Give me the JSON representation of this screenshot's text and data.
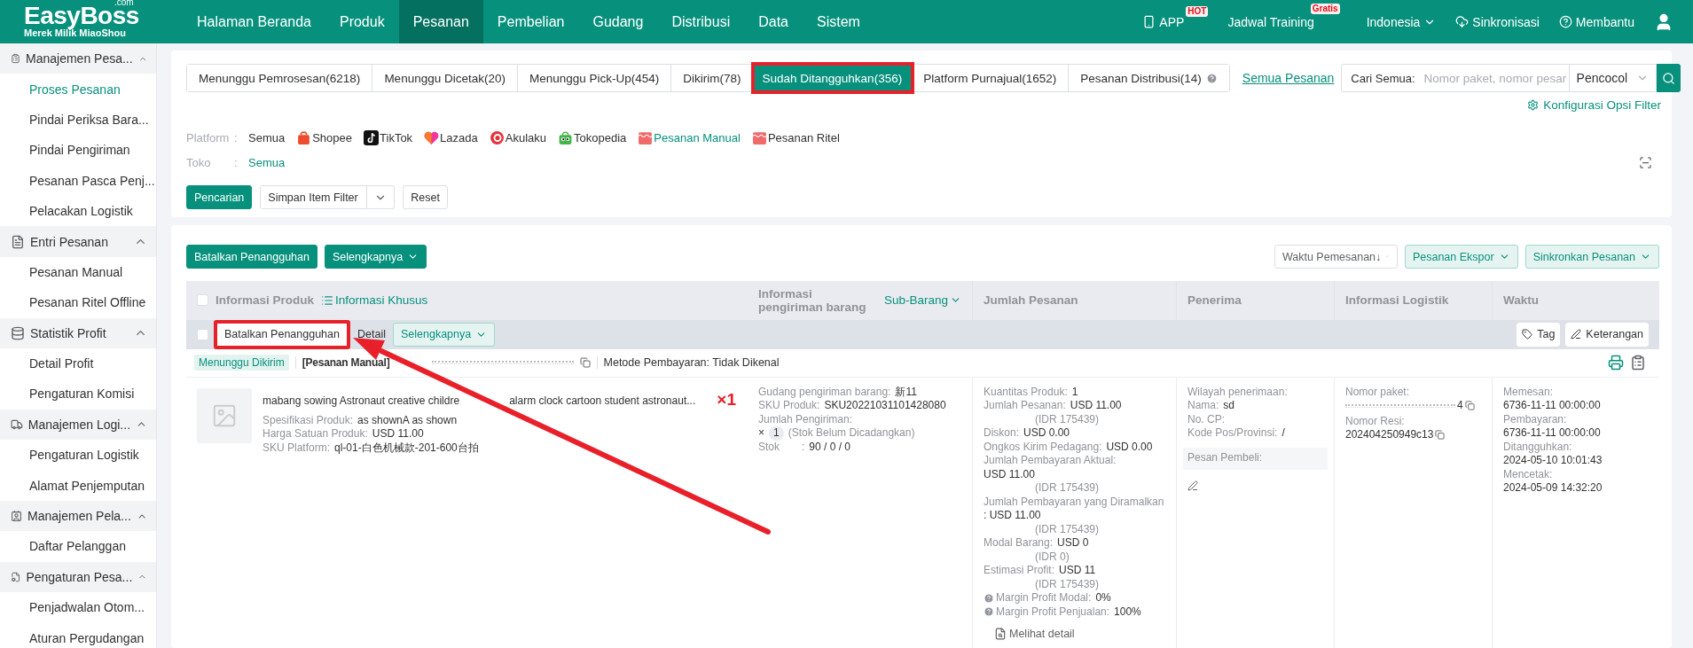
{
  "brand": {
    "name": "EasyBoss",
    "domain": ".com",
    "tagline": "Merek Milik MiaoShou"
  },
  "nav": [
    {
      "label": "Halaman Beranda",
      "selected": false
    },
    {
      "label": "Produk",
      "selected": false
    },
    {
      "label": "Pesanan",
      "selected": true
    },
    {
      "label": "Pembelian",
      "selected": false
    },
    {
      "label": "Gudang",
      "selected": false
    },
    {
      "label": "Distribusi",
      "selected": false
    },
    {
      "label": "Data",
      "selected": false
    },
    {
      "label": "Sistem",
      "selected": false
    }
  ],
  "header_actions": [
    {
      "kind": "app",
      "label": "APP",
      "badge": "HOT"
    },
    {
      "kind": "training",
      "label": "Jadwal Training",
      "badge": "Gratis"
    },
    {
      "kind": "language",
      "label": "Indonesia"
    },
    {
      "kind": "sync",
      "label": "Sinkronisasi"
    },
    {
      "kind": "help",
      "label": "Membantu"
    },
    {
      "kind": "user"
    }
  ],
  "sidebar": [
    {
      "label": "Manajemen Pesa...",
      "expanded": true,
      "children": [
        {
          "label": "Proses Pesanan",
          "selected": true
        },
        {
          "label": "Pindai Periksa Bara...",
          "selected": false
        },
        {
          "label": "Pindai Pengiriman",
          "selected": false
        },
        {
          "label": "Pesanan Pasca Penj...",
          "selected": false
        },
        {
          "label": "Pelacakan Logistik",
          "selected": false
        }
      ]
    },
    {
      "label": "Entri Pesanan",
      "expanded": true,
      "children": [
        {
          "label": "Pesanan Manual",
          "selected": false
        },
        {
          "label": "Pesanan Ritel Offline",
          "selected": false
        }
      ]
    },
    {
      "label": "Statistik Profit",
      "expanded": true,
      "children": [
        {
          "label": "Detail Profit",
          "selected": false
        },
        {
          "label": "Pengaturan Komisi",
          "selected": false
        }
      ]
    },
    {
      "label": "Manajemen Logi...",
      "expanded": true,
      "children": [
        {
          "label": "Pengaturan Logistik",
          "selected": false
        },
        {
          "label": "Alamat Penjemputan",
          "selected": false
        }
      ]
    },
    {
      "label": "Manajemen Pela...",
      "expanded": true,
      "children": [
        {
          "label": "Daftar Pelanggan",
          "selected": false
        }
      ]
    },
    {
      "label": "Pengaturan Pesa...",
      "expanded": true,
      "children": [
        {
          "label": "Penjadwalan Otom...",
          "selected": false
        },
        {
          "label": "Aturan Pergudangan",
          "selected": false
        }
      ]
    }
  ],
  "status_tabs": [
    {
      "label": "Menunggu Pemrosesan(6218)",
      "selected": false,
      "annotated": false,
      "help": false
    },
    {
      "label": "Menunggu Dicetak(20)",
      "selected": false,
      "annotated": false,
      "help": false
    },
    {
      "label": "Menunggu Pick-Up(454)",
      "selected": false,
      "annotated": false,
      "help": false
    },
    {
      "label": "Dikirim(78)",
      "selected": false,
      "annotated": false,
      "help": false
    },
    {
      "label": "Sudah Ditangguhkan(356)",
      "selected": true,
      "annotated": true,
      "help": false
    },
    {
      "label": "Platform Purnajual(1652)",
      "selected": false,
      "annotated": false,
      "help": false
    },
    {
      "label": "Pesanan Distribusi(14)",
      "selected": false,
      "annotated": false,
      "help": true
    }
  ],
  "all_orders_link": "Semua Pesanan",
  "search": {
    "label": "Cari Semua:",
    "placeholder": "Nomor paket, nomor pesar",
    "match": "Pencocol"
  },
  "filter_config": "Konfigurasi Opsi Filter",
  "filters": {
    "platform_label": "Platform",
    "separator": ":",
    "platforms": [
      {
        "kind": "all",
        "label": "Semua",
        "selected": false
      },
      {
        "kind": "shopee",
        "label": "Shopee",
        "selected": false
      },
      {
        "kind": "tiktok",
        "label": "TikTok",
        "selected": false
      },
      {
        "kind": "lazada",
        "label": "Lazada",
        "selected": false
      },
      {
        "kind": "akulaku",
        "label": "Akulaku",
        "selected": false
      },
      {
        "kind": "tokopedia",
        "label": "Tokopedia",
        "selected": false
      },
      {
        "kind": "manual",
        "label": "Pesanan Manual",
        "selected": true
      },
      {
        "kind": "retail",
        "label": "Pesanan Ritel",
        "selected": false
      }
    ],
    "store_label": "Toko",
    "store_value": "Semua"
  },
  "filter_buttons": {
    "search": "Pencarian",
    "save": "Simpan Item Filter",
    "reset": "Reset"
  },
  "toolbar": {
    "resume": "Batalkan Penangguhan",
    "more": "Selengkapnya",
    "sort": "Waktu Pemesanan↓",
    "export": "Pesanan Ekspor",
    "sync": "Sinkronkan Pesanan"
  },
  "table": {
    "header_checked": false,
    "product": "Informasi Produk",
    "special": "Informasi Khusus",
    "shipping": "Informasi pengiriman barang",
    "sub_items": "Sub-Barang",
    "columns": [
      "Jumlah Pesanan",
      "Penerima",
      "Informasi Logistik",
      "Waktu"
    ]
  },
  "batch_bar": {
    "checked": false,
    "actions": [
      {
        "kind": "plain",
        "label": "Batalkan Penangguhan",
        "annotated": true
      },
      {
        "kind": "link",
        "label": "Detail",
        "annotated": false
      },
      {
        "kind": "dropdown",
        "label": "Selengkapnya",
        "annotated": false
      }
    ],
    "tag": "Tag",
    "note": "Keterangan"
  },
  "order": {
    "status": "Menunggu Dikirim",
    "source": "[Pesanan Manual]",
    "payment": "Metode Pembayaran: Tidak Dikenal",
    "product": {
      "title_parts": [
        "mabang sowing Astronaut creative childre",
        "alarm clock cartoon student astronaut..."
      ],
      "quantity": "×1",
      "fields": [
        {
          "label": "Spesifikasi Produk:",
          "value": "as shownA as shown"
        },
        {
          "label": "Harga Satuan Produk:",
          "value": "USD 11.00"
        },
        {
          "label": "SKU Platform:",
          "value": "ql-01-白色机械款-201-600台拍"
        }
      ]
    },
    "shipping": {
      "lines": [
        {
          "label": "Gudang pengiriman barang:",
          "value": "新11"
        },
        {
          "label": "SKU Produk:",
          "value": "SKU20221031101428080"
        },
        {
          "label": "Jumlah Pengiriman:"
        }
      ],
      "times": "×",
      "count": "1",
      "note": "(Stok Belum Dicadangkan)",
      "stock_label": "Stok",
      "stock_sep": ":",
      "stock_value": "90 / 0 / 0"
    },
    "amounts": [
      {
        "kind": "inline",
        "label": "Kuantitas Produk:",
        "value": "1"
      },
      {
        "kind": "inline",
        "label": "Jumlah Pesanan:",
        "value": "USD 11.00",
        "sub": "(IDR 175439)"
      },
      {
        "kind": "inline",
        "label": "Diskon:",
        "value": "USD 0.00"
      },
      {
        "kind": "inline",
        "label": "Ongkos Kirim Pedagang:",
        "value": "USD 0.00"
      },
      {
        "kind": "stacked",
        "label": "Jumlah Pembayaran Aktual:",
        "value": "USD 11.00",
        "sub": "(IDR 175439)"
      },
      {
        "kind": "stacked",
        "label": "Jumlah Pembayaran yang Diramalkan",
        "value": ": USD 11.00",
        "sub": "(IDR 175439)"
      },
      {
        "kind": "inline",
        "label": "Modal Barang:",
        "value": "USD 0",
        "sub": "(IDR 0)"
      },
      {
        "kind": "inline",
        "label": "Estimasi Profit:",
        "value": "USD 11",
        "sub": "(IDR 175439)"
      },
      {
        "kind": "help",
        "label": "Margin Profit Modal:",
        "value": "0%"
      },
      {
        "kind": "help",
        "label": "Margin Profit Penjualan:",
        "value": "100%"
      }
    ],
    "detail_link": "Melihat detail",
    "receiver": [
      {
        "label": "Wilayah penerimaan:"
      },
      {
        "label": "Nama:",
        "value": "sd"
      },
      {
        "label": "No. CP:"
      },
      {
        "label": "Kode Pos/Provinsi:",
        "value": "/"
      }
    ],
    "buyer_message": "Pesan Pembeli:",
    "logistics": [
      {
        "label": "Nomor paket:",
        "value": "4",
        "redacted": true
      },
      {
        "label": "Nomor Resi:",
        "value": "202404250949c13",
        "redacted": false
      }
    ],
    "times": [
      {
        "label": "Memesan:",
        "value": "6736-11-11 00:00:00"
      },
      {
        "label": "Pembayaran:",
        "value": "6736-11-11 00:00:00"
      },
      {
        "label": "Ditangguhkan:",
        "value": "2024-05-10 10:01:43"
      },
      {
        "label": "Mencetak:",
        "value": "2024-05-09 14:32:20"
      }
    ]
  }
}
